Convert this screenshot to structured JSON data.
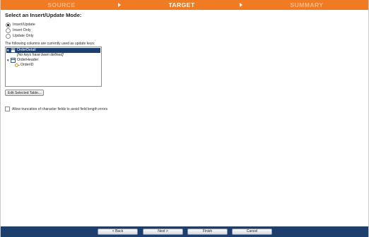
{
  "wizard": {
    "steps": [
      {
        "label": "SOURCE",
        "state": "inactive"
      },
      {
        "label": "TARGET",
        "state": "active"
      },
      {
        "label": "SUMMARY",
        "state": "inactive"
      }
    ],
    "accent_color": "#f07b22"
  },
  "mode": {
    "heading": "Select an Insert/Update Mode:",
    "options": [
      {
        "label": "Insert/Update",
        "selected": true
      },
      {
        "label": "Insert Only",
        "selected": false
      },
      {
        "label": "Update Only",
        "selected": false
      }
    ]
  },
  "keys": {
    "label": "The following columns are currently used as update keys:",
    "tree": [
      {
        "label": "OrderDetail",
        "kind": "table",
        "expanded": true,
        "selected": true
      },
      {
        "label": "[No keys have been defined]",
        "kind": "note"
      },
      {
        "label": "OrderHeader",
        "kind": "table",
        "expanded": true,
        "selected": false
      },
      {
        "label": "OrderID",
        "kind": "key"
      }
    ]
  },
  "edit_button": "Edit Selected Table...",
  "truncate_option": {
    "label": "Allow truncation of character fields to avoid field length errors",
    "checked": false
  },
  "footer": {
    "back": "< Back",
    "next": "Next >",
    "finish": "Finish",
    "cancel": "Cancel",
    "color": "#1d3f6e"
  }
}
